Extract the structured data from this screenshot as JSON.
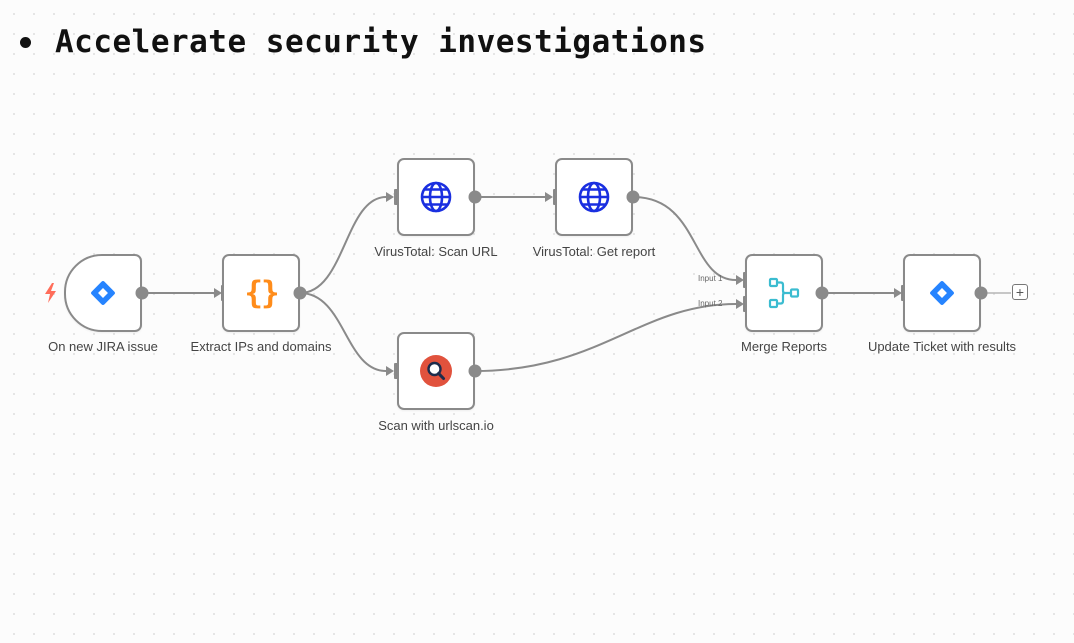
{
  "header": {
    "title": "Accelerate security investigations"
  },
  "colors": {
    "jira_blue": "#2684ff",
    "globe_blue": "#1a2fe0",
    "orange": "#ff8c1a",
    "urlscan_red": "#e1523d",
    "merge_teal": "#3bbcd0",
    "trigger_red": "#ff6d5a",
    "connector_gray": "#8a8a8a"
  },
  "nodes": {
    "jira_trigger": {
      "label": "On new JIRA issue",
      "icon": "jira-icon"
    },
    "extract": {
      "label": "Extract IPs and domains",
      "icon": "code-braces-icon"
    },
    "vt_scan": {
      "label": "VirusTotal: Scan URL",
      "icon": "globe-icon"
    },
    "vt_report": {
      "label": "VirusTotal: Get report",
      "icon": "globe-icon"
    },
    "urlscan": {
      "label": "Scan with urlscan.io",
      "icon": "magnifier-icon"
    },
    "merge": {
      "label": "Merge Reports",
      "icon": "merge-icon",
      "inputs": [
        "Input 1",
        "Input 2"
      ]
    },
    "update": {
      "label": "Update Ticket with results",
      "icon": "jira-icon"
    }
  },
  "add_button": "+"
}
